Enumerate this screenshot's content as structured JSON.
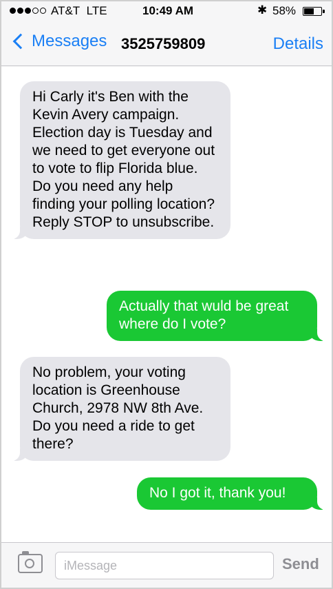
{
  "status_bar": {
    "carrier": "AT&T",
    "network": "LTE",
    "signal_bars_filled": 3,
    "signal_bars_total": 5,
    "time": "10:49 AM",
    "bluetooth_icon": "bluetooth-icon",
    "battery_percent": "58%",
    "battery_level": 0.58
  },
  "nav": {
    "back_label": "Messages",
    "contact": "3525759809",
    "details_label": "Details"
  },
  "messages": [
    {
      "direction": "incoming",
      "text": "Hi Carly it's Ben with the Kevin Avery campaign. Election day is Tuesday and we need to get everyone out to vote to flip Florida blue. Do you need any help finding your polling location? Reply STOP to unsubscribe."
    },
    {
      "direction": "outgoing",
      "text": "Actually that wuld be great where do I vote?"
    },
    {
      "direction": "incoming",
      "text": "No problem, your voting location is Greenhouse Church, 2978 NW 8th Ave. Do you need a ride to get there?"
    },
    {
      "direction": "outgoing",
      "text": "No I got it, thank you!"
    }
  ],
  "input_bar": {
    "camera_icon": "camera-icon",
    "placeholder": "iMessage",
    "value": "",
    "send_label": "Send"
  },
  "colors": {
    "accent": "#1a7ff5",
    "incoming_bubble": "#e5e5ea",
    "outgoing_bubble": "#1ac834"
  }
}
